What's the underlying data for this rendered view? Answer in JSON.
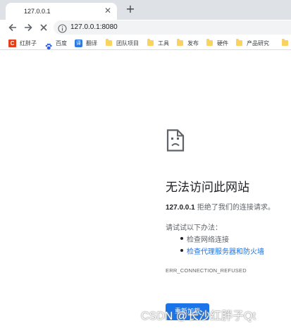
{
  "tab": {
    "title": "127.0.0.1",
    "close_glyph": "✕",
    "new_tab_glyph": "+"
  },
  "toolbar": {
    "back_icon": "arrow-left-icon",
    "forward_icon": "arrow-right-icon",
    "stop_icon": "close-icon",
    "address": "127.0.0.1:8080",
    "info_icon": "info-icon"
  },
  "bookmarks": [
    {
      "label": "红胖子",
      "icon": "csdn-icon"
    },
    {
      "label": "百度",
      "icon": "baidu-paw-icon"
    },
    {
      "label": "翻译",
      "icon": "translate-icon",
      "icon_text": "译"
    },
    {
      "label": "团队项目",
      "icon": "folder-icon"
    },
    {
      "label": "工具",
      "icon": "folder-icon"
    },
    {
      "label": "发布",
      "icon": "folder-icon"
    },
    {
      "label": "硬件",
      "icon": "folder-icon"
    },
    {
      "label": "产品研究",
      "icon": "folder-icon"
    }
  ],
  "error": {
    "icon": "broken-page-icon",
    "heading": "无法访问此网站",
    "host": "127.0.0.1",
    "message": "拒绝了我们的连接请求。",
    "try_label": "请试试以下办法：",
    "suggestions": [
      {
        "text": "检查网络连接",
        "link": false
      },
      {
        "text": "检查代理服务器和防火墙",
        "link": true
      }
    ],
    "code": "ERR_CONNECTION_REFUSED",
    "reload_label": "重新加载"
  },
  "watermark": "CSDN @长沙红胖子Qt",
  "colors": {
    "accent": "#1a73e8",
    "tabstrip": "#dee1e6",
    "omnibox": "#f1f3f4",
    "folder": "#f9d262"
  }
}
